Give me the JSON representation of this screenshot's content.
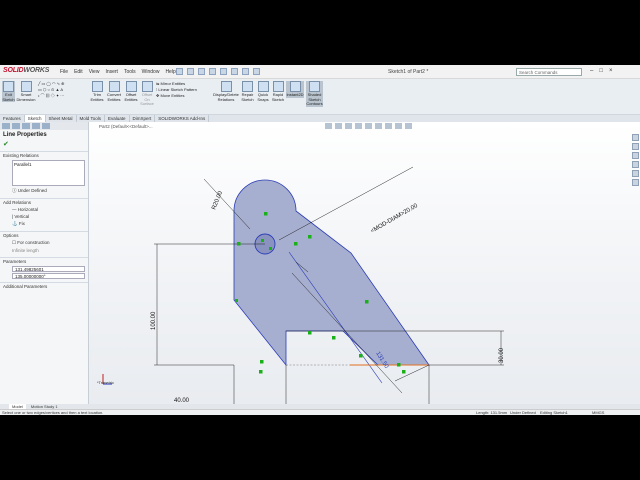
{
  "app": {
    "brand_red": "SOLID",
    "brand_gray": "WORKS",
    "doc_title": "Sketch1 of Part2 *"
  },
  "menu": [
    "File",
    "Edit",
    "View",
    "Insert",
    "Tools",
    "Window",
    "Help"
  ],
  "search": {
    "placeholder": "Search Commands"
  },
  "ribbon": {
    "exit_sketch": "Exit Sketch",
    "smart_dimension": "Smart Dimension",
    "trim_entities": "Trim Entities",
    "convert_entities": "Convert Entities",
    "offset_entities": "Offset Entities",
    "offset_on_surface": "Offset On Surface",
    "mirror_entities": "Mirror Entities",
    "linear_pattern": "Linear Sketch Pattern",
    "move_entities": "Move Entities",
    "display_relations": "Display/Delete Relations",
    "repair_sketch": "Repair Sketch",
    "quick_snaps": "Quick Snaps",
    "rapid_sketch": "Rapid Sketch",
    "instant2d": "Instant2D",
    "shaded_contours": "Shaded Sketch Contours"
  },
  "tabs": [
    "Features",
    "Sketch",
    "Sheet Metal",
    "Mold Tools",
    "Evaluate",
    "DimXpert",
    "SOLIDWORKS Add-Ins"
  ],
  "panel": {
    "title": "Line Properties",
    "existing_relations": "Existing Relations",
    "relation_item": "Parallel1",
    "under_defined": "Under Defined",
    "add_relations": "Add Relations",
    "horizontal": "Horizontal",
    "vertical": "Vertical",
    "fix": "Fix",
    "options": "Options",
    "for_construction": "For construction",
    "infinite_length": "Infinite length",
    "parameters": "Parameters",
    "param1": "131.49825601",
    "param2": "135.00000000°",
    "additional_parameters": "Additional Parameters"
  },
  "canvas": {
    "breadcrumb": "Part2 (Default<<Default>...",
    "dim_r20": "R20.00",
    "dim_dia": "<MOD-DIAM>20.00",
    "dim_100": "100.00",
    "dim_131": "131.50",
    "dim_30": "30.00",
    "dim_40": "40.00",
    "triad": "*Trimetric"
  },
  "bottom_tabs": [
    "Model",
    "Motion Study 1"
  ],
  "status": {
    "hint": "Select one or two edges/vertices and then a text location.",
    "length": "Length: 131.5mm",
    "defined": "Under Defined",
    "editing": "Editing Sketch1",
    "units": "MMGS"
  },
  "colors": {
    "sketch_fill": "#a7afd0",
    "sketch_line": "#2b3db5",
    "relation_green": "#19b019"
  }
}
